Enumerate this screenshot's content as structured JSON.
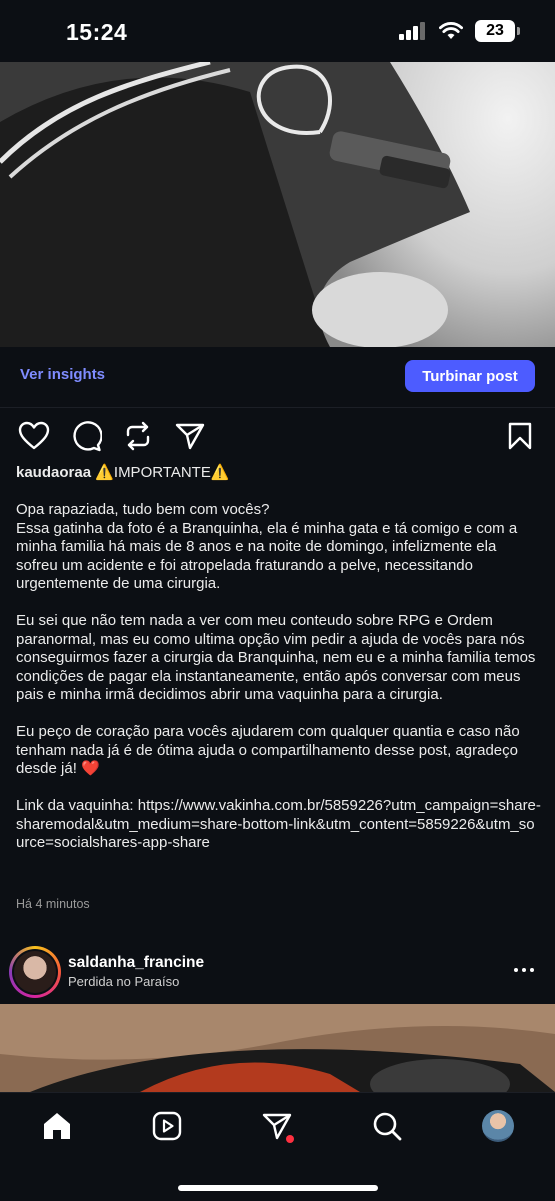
{
  "status_bar": {
    "time": "15:24",
    "battery": "23"
  },
  "post": {
    "insights_label": "Ver insights",
    "boost_label": "Turbinar post",
    "username": "kaudaoraa",
    "title": "⚠️IMPORTANTE⚠️",
    "paragraphs": [
      "Opa rapaziada, tudo bem com vocês?\nEssa gatinha da foto é a Branquinha, ela é minha gata e tá comigo e com a minha familia há mais de 8 anos e na noite de domingo, infelizmente ela sofreu um acidente e foi atropelada fraturando a pelve, necessitando urgentemente de uma cirurgia.",
      "Eu sei que não tem nada a ver com meu conteudo sobre RPG e Ordem paranormal, mas eu como ultima opção vim pedir a ajuda de vocês para nós conseguirmos fazer a cirurgia da Branquinha, nem eu e a minha familia temos condições de pagar ela instantaneamente, então após conversar com meus pais e minha irmã decidimos abrir uma vaquinha para a cirurgia.",
      "Eu peço de coração para vocês ajudarem com qualquer quantia e caso não tenham nada já é de ótima ajuda o compartilhamento desse post, agradeço desde já! ❤️",
      "Link da vaquinha: https://www.vakinha.com.br/5859226?utm_campaign=share-sharemodal&utm_medium=share-bottom-link&utm_content=5859226&utm_source=socialshares-app-share"
    ],
    "timestamp": "Há 4 minutos"
  },
  "next_post": {
    "username": "saldanha_francine",
    "location": "Perdida no Paraíso"
  },
  "icons": [
    "heart-icon",
    "comment-icon",
    "repost-icon",
    "share-icon",
    "bookmark-icon",
    "home-icon",
    "reels-icon",
    "direct-icon",
    "search-icon",
    "profile-avatar"
  ],
  "colors": {
    "accent": "#4d5cff",
    "link": "#7f8cff",
    "background": "#0c0f14",
    "notification_dot": "#ff3040"
  }
}
